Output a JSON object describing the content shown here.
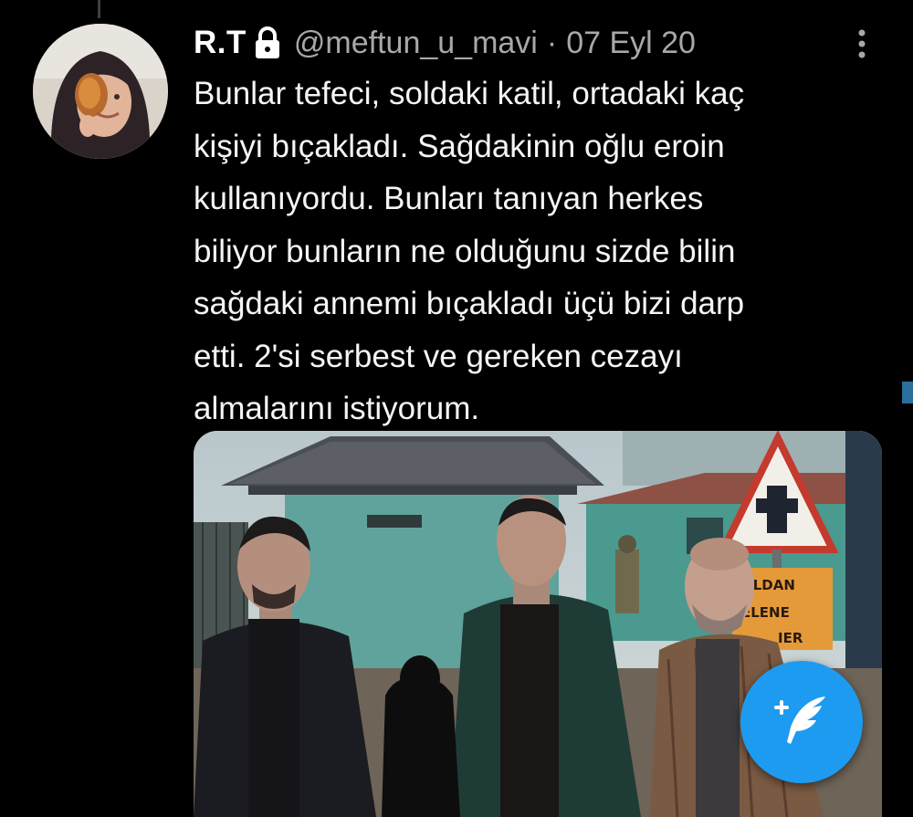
{
  "tweet": {
    "display_name": "R.T",
    "handle": "@meftun_u_mavi",
    "separator": "·",
    "date": "07 Eyl 20",
    "text": "Bunlar tefeci, soldaki katil, ortadaki kaç\nkişiyi bıçakladı. Sağdakinin oğlu eroin\nkullanıyordu. Bunları tanıyan herkes\nbiliyor bunların ne olduğunu sizde bilin\nsağdaki annemi bıçakladı üçü bizi darp\netti. 2'si serbest ve gereken cezayı\nalmalarını istiyorum.",
    "icons": {
      "protected": "lock-icon",
      "more": "more-vertical-icon"
    }
  },
  "media": {
    "sign_lines": [
      "OLDAN",
      "ELENE",
      "IER"
    ]
  },
  "fab": {
    "icon": "compose-tweet-icon",
    "color": "#1d9bf0"
  }
}
